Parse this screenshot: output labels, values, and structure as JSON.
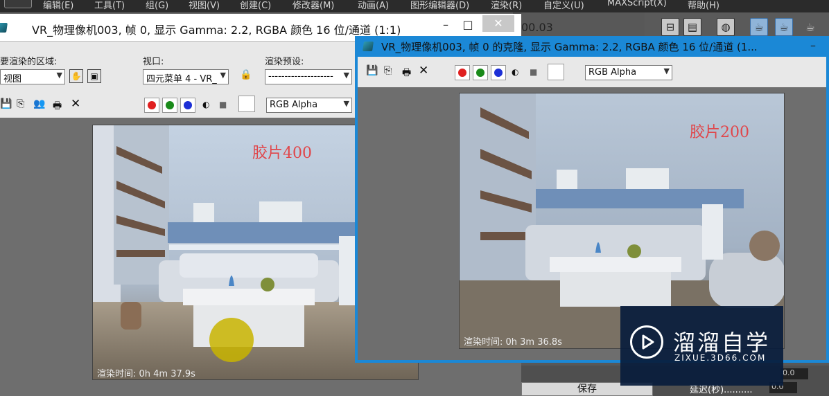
{
  "menu": [
    "编辑(E)",
    "工具(T)",
    "组(G)",
    "视图(V)",
    "创建(C)",
    "修改器(M)",
    "动画(A)",
    "图形编辑器(D)",
    "渲染(R)",
    "自定义(U)",
    "MAXScript(X)",
    "帮助(H)"
  ],
  "window1": {
    "title": "VR_物理像机003, 帧 0, 显示 Gamma: 2.2, RGBA 颜色 16 位/通道 (1:1)",
    "behind_title_fragment": "00.03",
    "area_label": "要渲染的区域:",
    "area_value": "视图",
    "viewport_label": "视口:",
    "viewport_value": "四元菜单 4 - VR_",
    "preset_label": "渲染预设:",
    "preset_value": "--------------------",
    "channel_value": "RGB Alpha",
    "film_label": "胶片400",
    "render_time": "渲染时间: 0h 4m 37.9s"
  },
  "window2": {
    "title": "VR_物理像机003, 帧 0 的克隆, 显示 Gamma: 2.2, RGBA 颜色 16 位/通道 (1...",
    "channel_value": "RGB Alpha",
    "film_label": "胶片200",
    "render_time": "渲染时间: 0h 3m 36.8s"
  },
  "window_buttons": {
    "minimize": "–",
    "maximize": "□",
    "close": "✕"
  },
  "bottom": {
    "save_label": "保存",
    "delay_label": "延迟(秒)..........",
    "delay_value": "0.0",
    "field_value": "0.0"
  },
  "watermark": {
    "brand": "溜溜自学",
    "url": "ZIXUE.3D66.COM"
  },
  "colors": {
    "red": "#e02020",
    "green": "#1a8a1a",
    "blue": "#1c2fd6",
    "accent": "#1b88d6"
  },
  "icons": {
    "save": "floppy-disk-icon",
    "copy": "copy-icon",
    "clone": "clone-icon",
    "print": "printer-icon",
    "clear": "close-icon",
    "mono": "half-circle-icon",
    "alpha": "gray-square-icon",
    "lock": "lock-icon",
    "region": "hand-region-icon"
  }
}
